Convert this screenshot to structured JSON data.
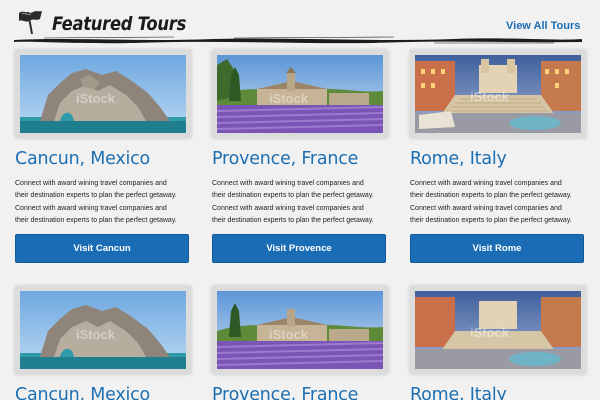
{
  "header": {
    "title": "Featured Tours",
    "view_all_label": "View All Tours"
  },
  "cards": [
    {
      "city": "Cancun, Mexico",
      "desc_line1": "Connect with award wining travel companies and",
      "desc_line2": "their destination experts to plan the perfect getaway.",
      "button": "Visit Cancun",
      "watermark": "iStock"
    },
    {
      "city": "Provence, France",
      "desc_line1": "Connect with award wining travel companies and",
      "desc_line2": "their destination experts to plan the perfect getaway.",
      "button": "Visit Provence",
      "watermark": "iStock"
    },
    {
      "city": "Rome, Italy",
      "desc_line1": "Connect with award wining travel companies and",
      "desc_line2": "their destination experts to plan the perfect getaway.",
      "button": "Visit Rome",
      "watermark": "iStock"
    },
    {
      "city": "Cancun, Mexico",
      "watermark": "iStock"
    },
    {
      "city": "Provence, France",
      "watermark": "iStock"
    },
    {
      "city": "Rome, Italy",
      "watermark": "iStock"
    }
  ],
  "colors": {
    "accent": "#1a6db5",
    "background": "#f1f1f1",
    "title_text": "#1b1b1b"
  },
  "icons": [
    "flag-icon"
  ]
}
